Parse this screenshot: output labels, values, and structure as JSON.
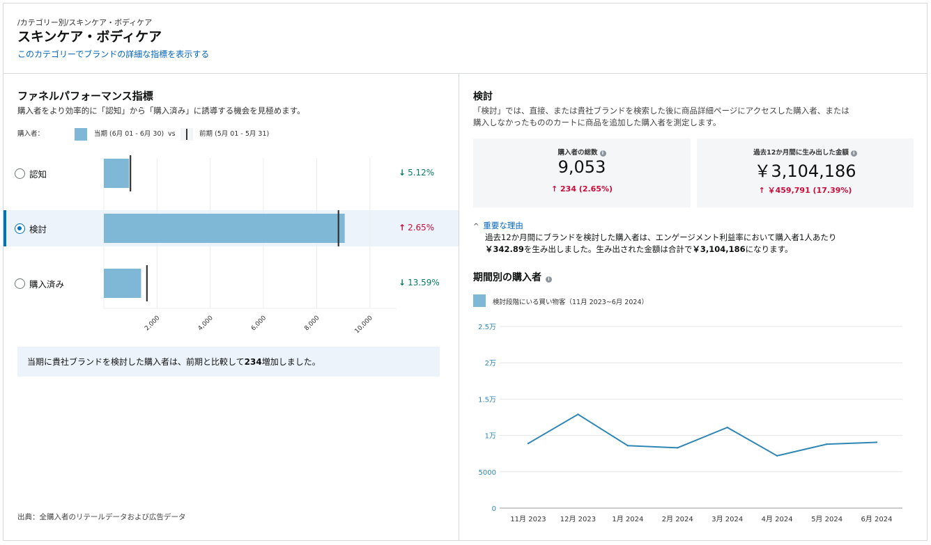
{
  "header": {
    "breadcrumb": "/カテゴリー別/スキンケア・ボディケア",
    "title": "スキンケア・ボディケア",
    "detail_link": "このカテゴリーでブランドの詳細な指標を表示する"
  },
  "funnel": {
    "title": "ファネルパフォーマンス指標",
    "subtitle": "購入者をより効率的に「認知」から「購入済み」に誘導する機会を見極めます。",
    "legend": {
      "prefix": "購入者：",
      "current_label": "当期 (6月 01 - 6月 30)",
      "vs": "vs",
      "previous_label": "前期 (5月 01 - 5月 31)"
    },
    "rows": [
      {
        "label": "認知",
        "selected": false,
        "direction": "down",
        "arrow": "↓",
        "change": "5.12%"
      },
      {
        "label": "検討",
        "selected": true,
        "direction": "up",
        "arrow": "↑",
        "change": "2.65%"
      },
      {
        "label": "購入済み",
        "selected": false,
        "direction": "down",
        "arrow": "↓",
        "change": "13.59%"
      }
    ],
    "note_prefix": "当期に貴社ブランドを検討した購入者は、前期と比較して",
    "note_value": "234",
    "note_suffix": "増加しました。",
    "source": "出典：全購入者のリテールデータおよび広告データ"
  },
  "detail": {
    "title": "検討",
    "description": "「検討」では、直接、または貴社ブランドを検索した後に商品詳細ページにアクセスした購入者、または購入しなかったもののカートに商品を追加した購入者を測定します。",
    "kpis": [
      {
        "label": "購入者の総数",
        "value": "9,053",
        "arrow": "↑",
        "change": "234 (2.65%)"
      },
      {
        "label": "過去12か月間に生み出した金額",
        "value": "￥3,104,186",
        "arrow": "↑",
        "change": "￥459,791 (17.39%)"
      }
    ],
    "reason_toggle": "重要な理由",
    "reason_chevron": "^",
    "reason_text_1": "過去12か月間にブランドを検討した購入者は、エンゲージメント利益率において購入者1人あたり",
    "reason_value_1": "￥342.89",
    "reason_text_2": "を生み出しました。生み出された金額は合計で",
    "reason_value_2": "￥3,104,186",
    "reason_text_3": "になります。",
    "timeseries_title": "期間別の購入者",
    "timeseries_legend": "検討段階にいる買い物客（11月 2023~6月 2024）"
  },
  "chart_data": [
    {
      "type": "bar",
      "orientation": "horizontal",
      "categories": [
        "認知",
        "検討",
        "購入済み"
      ],
      "series": [
        {
          "name": "当期 (6月 01 - 6月 30)",
          "values": [
            950,
            9053,
            1400
          ]
        },
        {
          "name": "前期 (5月 01 - 5月 31)",
          "values": [
            1000,
            8819,
            1620
          ]
        }
      ],
      "xlim": [
        0,
        11000
      ],
      "x_ticks": [
        2000,
        4000,
        6000,
        8000,
        10000
      ],
      "x_tick_labels": [
        "2,000",
        "4,000",
        "6,000",
        "8,000",
        "10,000"
      ],
      "grid": true,
      "colors": {
        "current": "#7fb8d6",
        "previous": "#333333"
      }
    },
    {
      "type": "line",
      "x": [
        "11月 2023",
        "12月 2023",
        "1月 2024",
        "2月 2024",
        "3月 2024",
        "4月 2024",
        "5月 2024",
        "6月 2024"
      ],
      "series": [
        {
          "name": "検討段階にいる買い物客（11月 2023~6月 2024）",
          "values": [
            8900,
            12900,
            8600,
            8300,
            11100,
            7200,
            8800,
            9053
          ]
        }
      ],
      "ylim": [
        0,
        25000
      ],
      "y_ticks": [
        0,
        5000,
        10000,
        15000,
        20000,
        25000
      ],
      "y_tick_labels": [
        "0",
        "5000",
        "1万",
        "1.5万",
        "2万",
        "2.5万"
      ],
      "grid": true,
      "color": "#2e86b5"
    }
  ]
}
